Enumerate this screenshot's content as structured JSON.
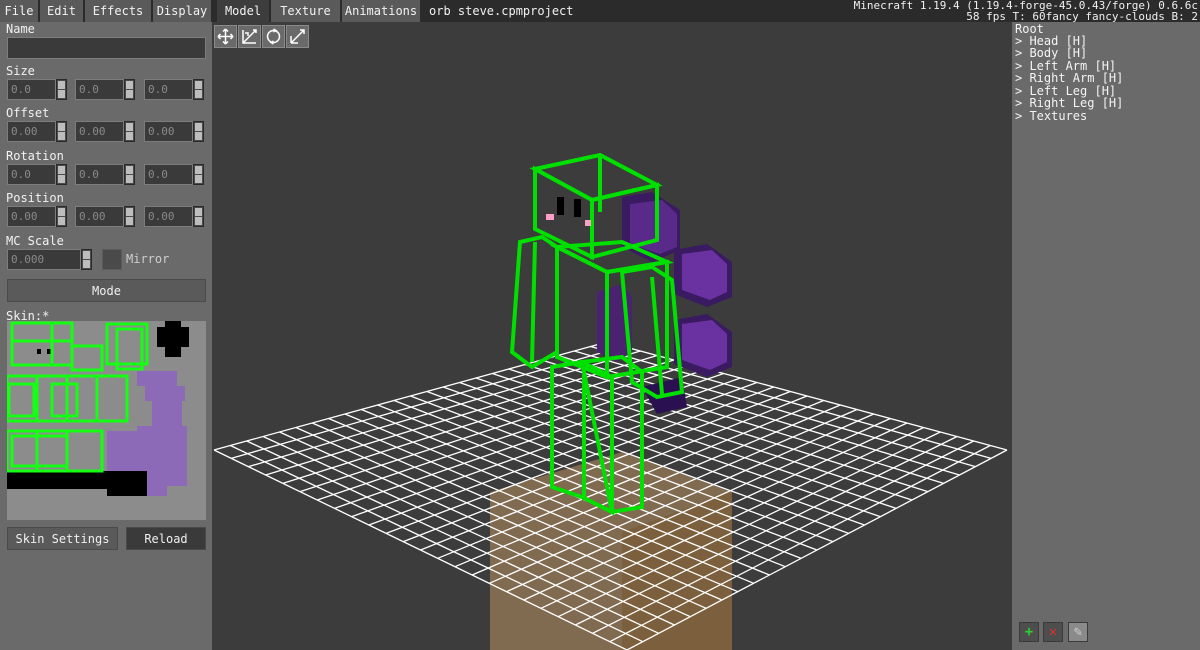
{
  "menu": {
    "items": [
      "File",
      "Edit",
      "Effects",
      "Display",
      "Model",
      "Texture",
      "Animations"
    ],
    "active": "Model"
  },
  "project_title": "orb steve.cpmproject",
  "version_info": {
    "line1": "Minecraft 1.19.4 (1.19.4-forge-45.0.43/forge) 0.6.6c",
    "line2": "58 fps T: 60fancy fancy-clouds B: 2"
  },
  "left_panel": {
    "name_label": "Name",
    "name_value": "",
    "size_label": "Size",
    "size_values": [
      "0.0",
      "0.0",
      "0.0"
    ],
    "offset_label": "Offset",
    "offset_values": [
      "0.00",
      "0.00",
      "0.00"
    ],
    "rotation_label": "Rotation",
    "rotation_values": [
      "0.0",
      "0.0",
      "0.0"
    ],
    "position_label": "Position",
    "position_values": [
      "0.00",
      "0.00",
      "0.00"
    ],
    "mc_scale_label": "MC Scale",
    "mc_scale_value": "0.000",
    "mirror_label": "Mirror",
    "mode_button": "Mode",
    "skin_label": "Skin:*",
    "skin_settings_button": "Skin Settings",
    "reload_button": "Reload"
  },
  "tools": [
    "move-icon",
    "scale-icon",
    "rotate-icon",
    "size-icon"
  ],
  "tree": {
    "items": [
      "Root",
      "> Head [H]",
      "> Body [H]",
      "> Left Arm [H]",
      "> Right Arm [H]",
      "> Left Leg [H]",
      "> Right Leg [H]",
      "> Textures"
    ]
  },
  "right_buttons": [
    "add-icon",
    "delete-icon",
    "edit-icon"
  ],
  "colors": {
    "model_green": "#00e000",
    "orb_purple": "#5a2a8a",
    "grid_white": "#ffffff",
    "block_tan": "#c8a46a"
  }
}
